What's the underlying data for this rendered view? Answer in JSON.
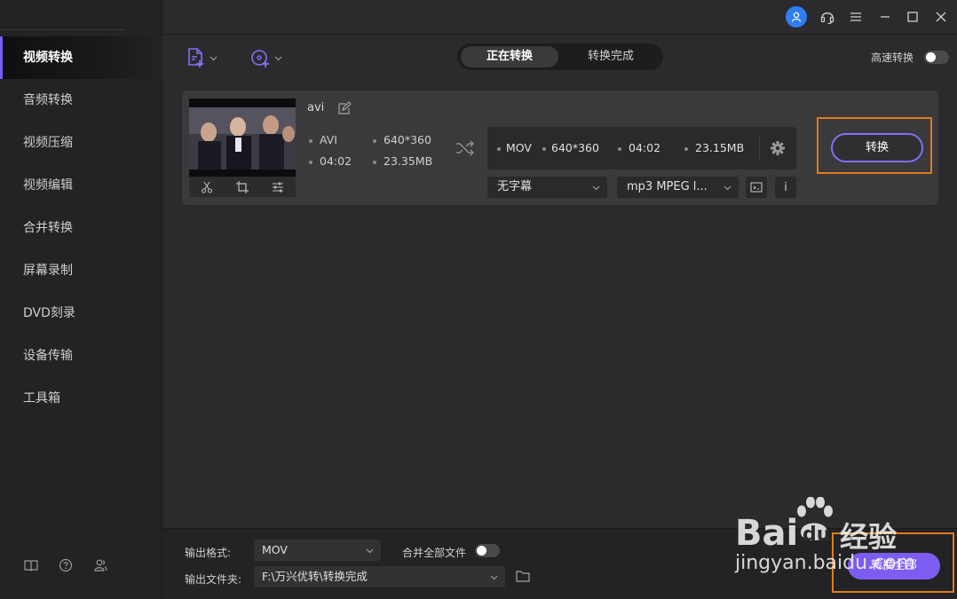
{
  "sidebar": {
    "items": [
      {
        "label": "视频转换"
      },
      {
        "label": "音频转换"
      },
      {
        "label": "视频压缩"
      },
      {
        "label": "视频编辑"
      },
      {
        "label": "合并转换"
      },
      {
        "label": "屏幕录制"
      },
      {
        "label": "DVD刻录"
      },
      {
        "label": "设备传输"
      },
      {
        "label": "工具箱"
      }
    ],
    "footer_icons": [
      "book-icon",
      "help-icon",
      "user-group-icon"
    ]
  },
  "titlebar": {
    "icons": [
      "user-icon",
      "headset-icon",
      "menu-icon",
      "minimize-icon",
      "maximize-icon",
      "close-icon"
    ]
  },
  "toolbar": {
    "tabs": [
      {
        "label": "正在转换",
        "active": true
      },
      {
        "label": "转换完成",
        "active": false
      }
    ],
    "high_speed_label": "高速转换",
    "high_speed_on": false
  },
  "file": {
    "name": "avi",
    "source": {
      "format": "AVI",
      "resolution": "640*360",
      "duration": "04:02",
      "size": "23.35MB"
    },
    "output": {
      "format": "MOV",
      "resolution": "640*360",
      "duration": "04:02",
      "size": "23.15MB"
    },
    "subtitle": "无字幕",
    "audio": "mp3 MPEG l...",
    "info_label": "i",
    "convert_label": "转换"
  },
  "bottom": {
    "output_format_label": "输出格式:",
    "output_format_value": "MOV",
    "merge_label": "合并全部文件",
    "merge_on": false,
    "output_folder_label": "输出文件夹:",
    "output_folder_value": "F:\\万兴优转\\转换完成",
    "convert_all_label": "转换全部"
  },
  "watermark": {
    "brand": "Bai",
    "brand_tail": "du",
    "site_cn": "经验",
    "url": "jingyan.baidu.com"
  },
  "colors": {
    "accent": "#7d5cf2",
    "highlight": "#e07a1f",
    "user_blue": "#2f7df6"
  }
}
